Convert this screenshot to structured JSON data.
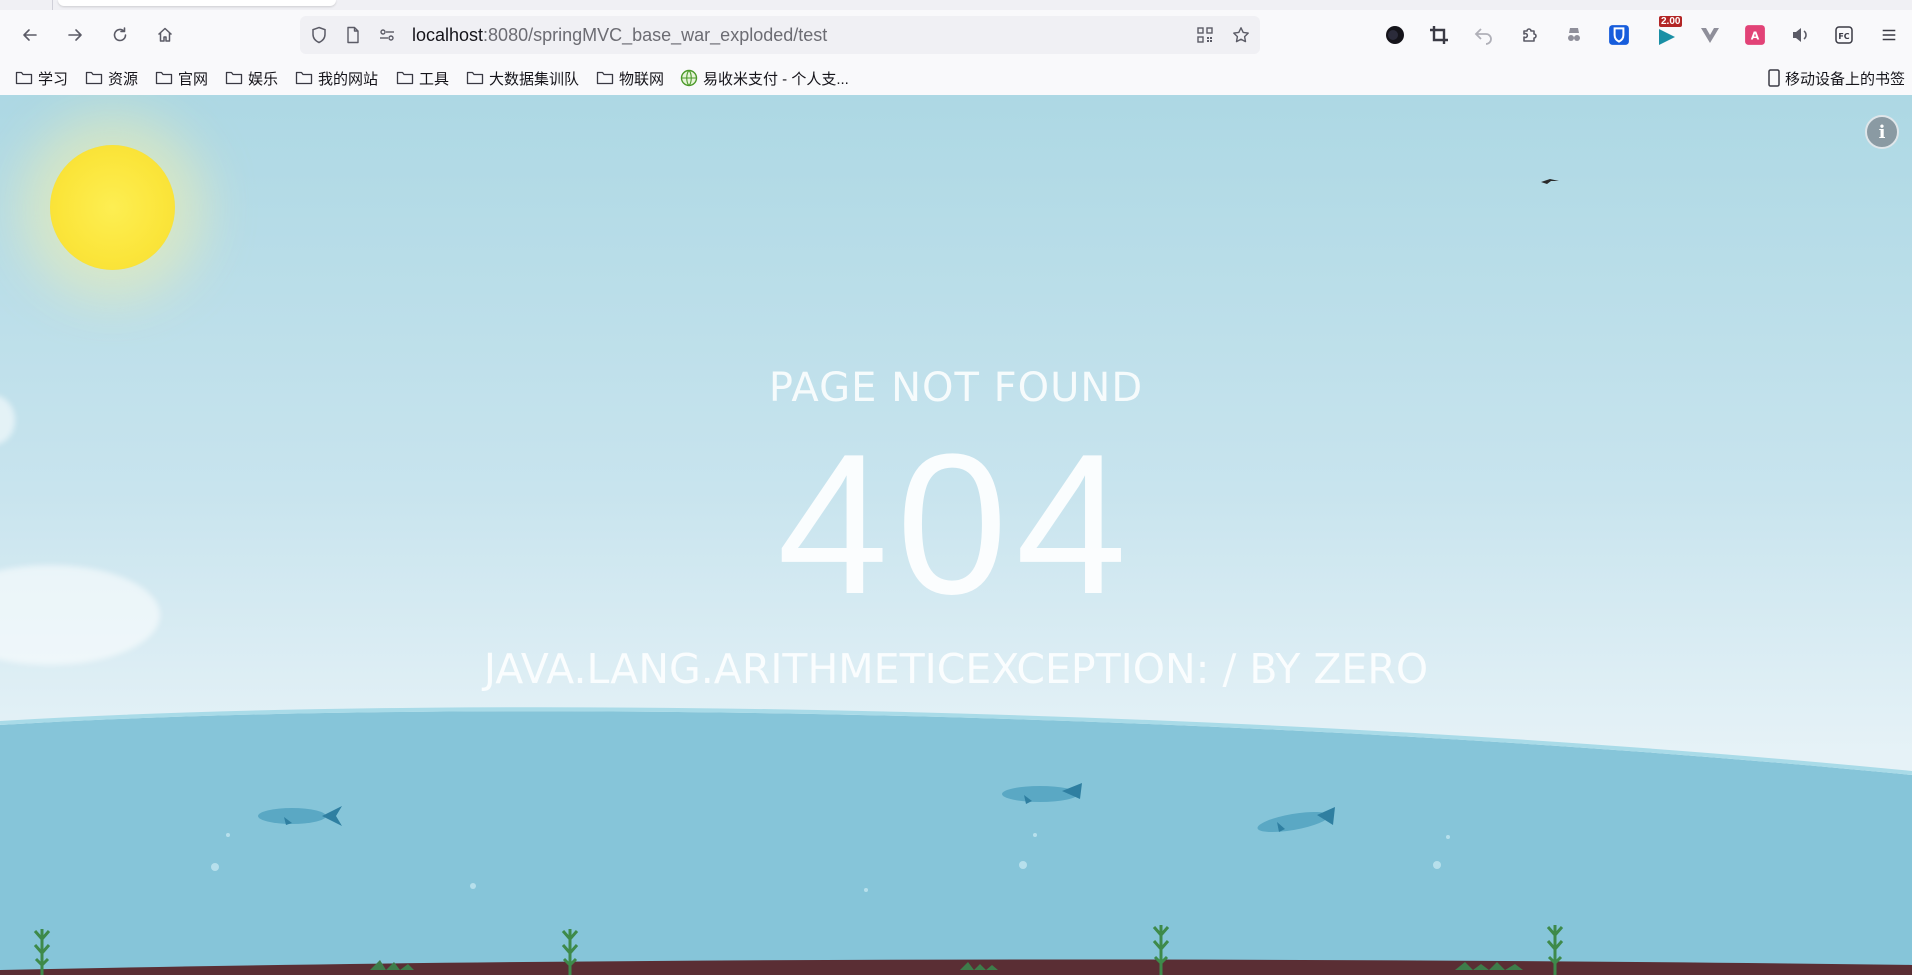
{
  "browser": {
    "url_host": "localhost",
    "url_path": ":8080/springMVC_base_war_exploded/test",
    "extension_badge": "2.00",
    "bookmarks": [
      {
        "label": "学习",
        "icon": "folder-icon"
      },
      {
        "label": "资源",
        "icon": "folder-icon"
      },
      {
        "label": "官网",
        "icon": "folder-icon"
      },
      {
        "label": "娱乐",
        "icon": "folder-icon"
      },
      {
        "label": "我的网站",
        "icon": "folder-icon"
      },
      {
        "label": "工具",
        "icon": "folder-icon"
      },
      {
        "label": "大数据集训队",
        "icon": "folder-icon"
      },
      {
        "label": "物联网",
        "icon": "folder-icon"
      },
      {
        "label": "易收米支付 - 个人支...",
        "icon": "globe-icon"
      }
    ],
    "mobile_bookmarks": "移动设备上的书签"
  },
  "page": {
    "title": "PAGE NOT FOUND",
    "code": "404",
    "detail": "JAVA.LANG.ARITHMETICEXCEPTION: / BY ZERO"
  },
  "colors": {
    "sky_top": "#add8e4",
    "sea": "#86c5d9",
    "sun": "#fbe53a",
    "seabed": "#5a2e34"
  }
}
